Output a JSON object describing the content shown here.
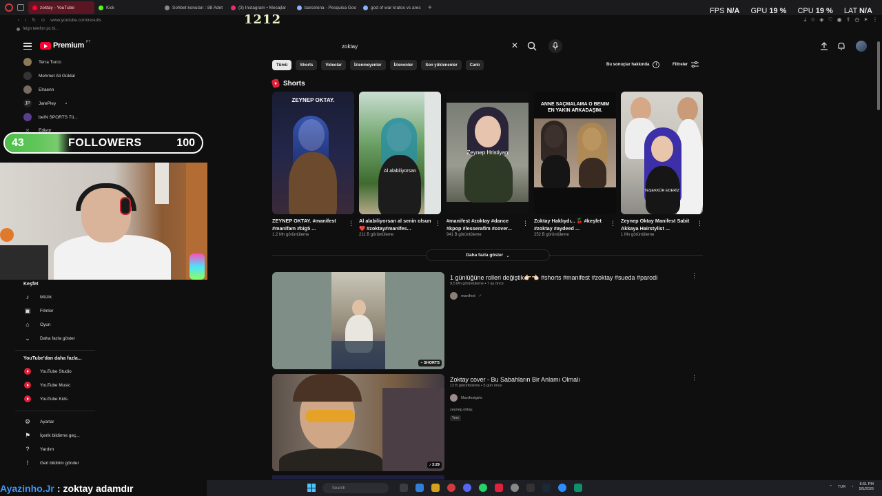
{
  "browser": {
    "tabs": [
      {
        "label": "zoktay - YouTube",
        "active": true,
        "favicon_color": "#ff0033"
      },
      {
        "label": "Kick",
        "active": false,
        "favicon_color": "#53fc18"
      },
      {
        "label": "Sohbet konuları : 88 Adet",
        "active": false,
        "favicon_color": "#888888"
      },
      {
        "label": "(3) Instagram • Mesajlar",
        "active": false,
        "favicon_color": "#e1306c"
      },
      {
        "label": "barcelona - Pesquisa Goo",
        "active": false,
        "favicon_color": "#8ab4f8"
      },
      {
        "label": "god of war kratos vs ares",
        "active": false,
        "favicon_color": "#8ab4f8"
      }
    ],
    "url": "www.youtube.com/results",
    "bookmark": "feign telefon pc bi..."
  },
  "sysmonitor": {
    "fps_label": "FPS",
    "fps_value": "N/A",
    "gpu_label": "GPU",
    "gpu_value": "19 %",
    "cpu_label": "CPU",
    "cpu_value": "19 %",
    "lat_label": "LAT",
    "lat_value": "N/A"
  },
  "overlay": {
    "counter": "1212",
    "followers_current": "43",
    "followers_label": "FOLLOWERS",
    "followers_goal": "100",
    "followers_progress": 0.43,
    "chat_user": "Ayazinho.Jr",
    "chat_sep": ":",
    "chat_message": "zoktay adamdır"
  },
  "youtube": {
    "logo_text": "Premium",
    "region": "PT",
    "search_query": "zoktay",
    "sidebar": {
      "subscriptions": [
        "Terra Turco",
        "Mehmet Ali Güldal",
        "Elraenn",
        "JarePley",
        "beIN SPORTS Tü...",
        "Ediyor"
      ],
      "explore": [
        {
          "label": "Keşfet",
          "icon": "compass-icon"
        },
        {
          "label": "Müzik",
          "icon": "music-note-icon"
        },
        {
          "label": "Filmler",
          "icon": "film-icon"
        },
        {
          "label": "Oyun",
          "icon": "gamepad-icon"
        },
        {
          "label": "Daha fazla göster",
          "icon": "chevron-down-icon"
        }
      ],
      "more_from_header": "YouTube'dan daha fazla...",
      "more_from": [
        "YouTube Studio",
        "YouTube Music",
        "YouTube Kids"
      ],
      "settings": [
        {
          "label": "Ayarlar",
          "icon": "gear-icon"
        },
        {
          "label": "İçerik bildirme geç...",
          "icon": "flag-icon"
        },
        {
          "label": "Yardım",
          "icon": "help-icon"
        },
        {
          "label": "Geri bildirim gönder",
          "icon": "feedback-icon"
        }
      ]
    },
    "chips": [
      "Tümü",
      "Shorts",
      "Videolar",
      "İzlenmeyenler",
      "İzlenenler",
      "Son yüklenenler",
      "Canlı"
    ],
    "about_results": "Bu sonuçlar hakkında",
    "filters": "Filtreler",
    "shorts_header": "Shorts",
    "shorts": [
      {
        "overlay": "ZEYNEP OKTAY.",
        "in_thumb": "",
        "title": "ZEYNEP OKTAY. #manifest #manifam #big5 ...",
        "views": "1,2 Mn görüntüleme"
      },
      {
        "overlay": "",
        "in_thumb": "Al alabiliyorsan",
        "title": "Al alabiliyorsan al senin olsun❤️ #zoktay#manifes...",
        "views": "211 B görüntüleme"
      },
      {
        "overlay": "",
        "in_thumb": "Zeynep Hristiyan",
        "title": "#manifest #zoktay #dance #kpop #lesserafim #cover...",
        "views": "941 B görüntüleme"
      },
      {
        "overlay": "ANNE SAÇMALAMA O BENIM EN YAKIN ARKADAŞIM.",
        "in_thumb": "",
        "title": "Zoktay Haklıydı... 🍒 #keşfet #zoktay #aydeed ...",
        "views": "252 B görüntüleme"
      },
      {
        "overlay": "",
        "in_thumb": "TEŞEKKÜR EDERİZ",
        "title": "Zeynep Oktay Manifest Sabit Akkaya Hairstylist ...",
        "views": "1 Mn görüntüleme"
      }
    ],
    "show_more": "Daha fazla göster",
    "videos": [
      {
        "title": "1 günlüğüne rolleri değiştik👉🏻👈🏻 #shorts #manifest #zoktay #sueda #parodi",
        "meta": "9,5 Mn görüntüleme • 7 ay önce",
        "channel": "manifest",
        "badge": "SHORTS",
        "desc": "",
        "tag": ""
      },
      {
        "title": "Zoktay cover - Bu Sabahların Bir Anlamı Olmalı",
        "meta": "12 B görüntüleme • 5 gün önce",
        "channel": "Manifestgirls",
        "badge": "3:29",
        "desc": "zeynep.oktay.",
        "tag": "Yeni"
      }
    ]
  },
  "taskbar": {
    "search_placeholder": "Search",
    "time": "8:51 PM",
    "date": "5/5/2026",
    "lang": "TUR"
  }
}
